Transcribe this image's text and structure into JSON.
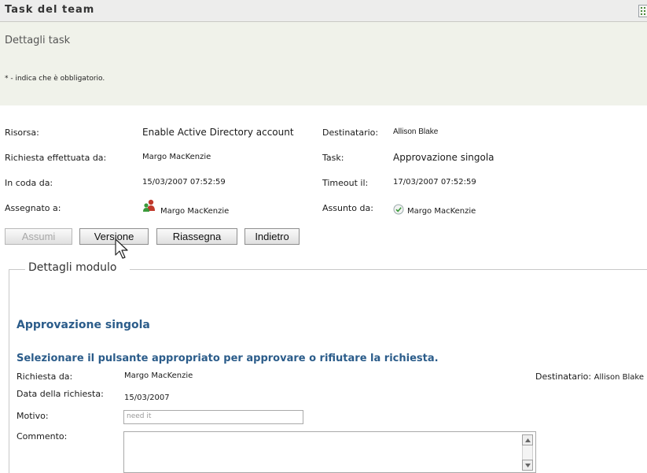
{
  "header": {
    "title": "Task del team"
  },
  "panel": {
    "title": "Dettagli task",
    "required_note": "* - indica che è obbligatorio."
  },
  "details": {
    "risorsa_label": "Risorsa:",
    "risorsa_value": "Enable Active Directory account",
    "destinatario_label": "Destinatario:",
    "destinatario_value": "Allison Blake",
    "richiesta_label": "Richiesta effettuata da:",
    "richiesta_value": "Margo MacKenzie",
    "task_label": "Task:",
    "task_value": "Approvazione singola",
    "coda_label": "In coda da:",
    "coda_value": "15/03/2007 07:52:59",
    "timeout_label": "Timeout il:",
    "timeout_value": "17/03/2007 07:52:59",
    "assegnato_label": "Assegnato a:",
    "assegnato_value": "Margo MacKenzie",
    "assunto_label": "Assunto da:",
    "assunto_value": "Margo MacKenzie"
  },
  "buttons": {
    "assumi": "Assumi",
    "versione": "Versione",
    "riassegna": "Riassegna",
    "indietro": "Indietro"
  },
  "form": {
    "legend": "Dettagli modulo",
    "heading": "Approvazione singola",
    "instruction": "Selezionare il pulsante appropriato per approvare o rifiutare la richiesta.",
    "richiesta_da_label": "Richiesta da:",
    "richiesta_da_value": "Margo MacKenzie",
    "destinatario_label": "Destinatario:",
    "destinatario_value": "Allison Blake",
    "data_label": "Data della richiesta:",
    "data_value": "15/03/2007",
    "motivo_label": "Motivo:",
    "motivo_value": "need it",
    "commento_label": "Commento:",
    "commento_value": ""
  },
  "icons": {
    "menu": "grid-menu-icon",
    "assigned": "user-group-icon",
    "claimed": "check-circle-icon",
    "cursor": "mouse-pointer-icon"
  }
}
